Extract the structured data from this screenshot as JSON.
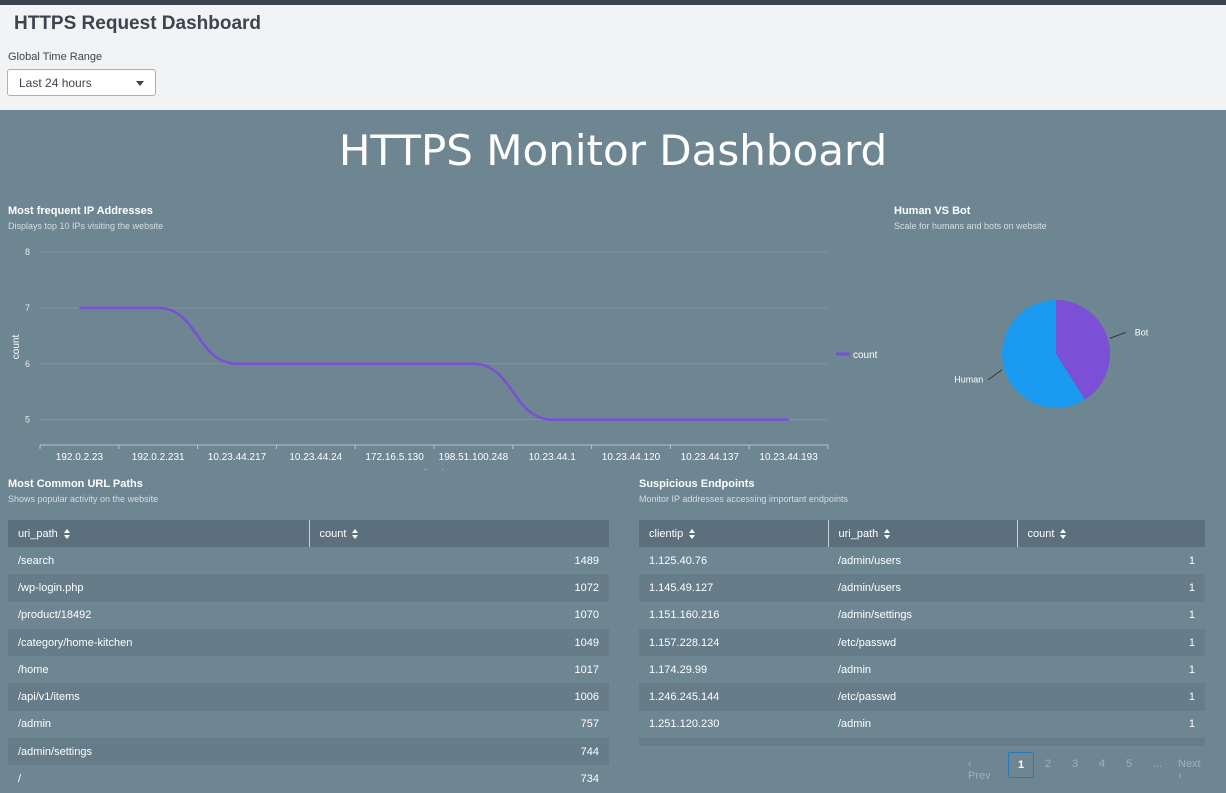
{
  "header": {
    "title": "HTTPS Request Dashboard",
    "time_range_label": "Global Time Range",
    "time_range_value": "Last 24 hours"
  },
  "dashboard_title": "HTTPS Monitor Dashboard",
  "colors": {
    "line": "#7b4fd6",
    "pie_human": "#1a9af0",
    "pie_bot": "#7b4fd6",
    "panel_bg": "#6e8592",
    "header_bg": "#f2f3f4",
    "pager_current_border": "#2a7ab8"
  },
  "ip_panel": {
    "title": "Most frequent IP Addresses",
    "subtitle": "Displays top 10 IPs visiting the website"
  },
  "bot_panel": {
    "title": "Human VS Bot",
    "subtitle": "Scale for humans and bots on website"
  },
  "chart_data": [
    {
      "type": "line",
      "x": [
        "192.0.2.23",
        "192.0.2.231",
        "10.23.44.217",
        "10.23.44.24",
        "172.16.5.130",
        "198.51.100.248",
        "10.23.44.1",
        "10.23.44.120",
        "10.23.44.137",
        "10.23.44.193"
      ],
      "series": [
        {
          "name": "count",
          "values": [
            7,
            7,
            6,
            6,
            6,
            6,
            5,
            5,
            5,
            5
          ]
        }
      ],
      "xlabel": "clientip",
      "ylabel": "count",
      "yticks": [
        5,
        6,
        7,
        8
      ],
      "ylim": [
        4.6,
        8
      ],
      "grid": true,
      "legend": "right"
    },
    {
      "type": "pie",
      "categories": [
        "Bot",
        "Human"
      ],
      "values": [
        41,
        59
      ],
      "legend": "labels"
    }
  ],
  "url_panel": {
    "title": "Most Common URL Paths",
    "subtitle": "Shows popular activity on the website",
    "headers": [
      "uri_path",
      "count"
    ],
    "rows": [
      [
        "/search",
        "1489"
      ],
      [
        "/wp-login.php",
        "1072"
      ],
      [
        "/product/18492",
        "1070"
      ],
      [
        "/category/home-kitchen",
        "1049"
      ],
      [
        "/home",
        "1017"
      ],
      [
        "/api/v1/items",
        "1006"
      ],
      [
        "/admin",
        "757"
      ],
      [
        "/admin/settings",
        "744"
      ],
      [
        "/",
        "734"
      ]
    ]
  },
  "endpoint_panel": {
    "title": "Suspicious Endpoints",
    "subtitle": "Monitor IP addresses accessing important endpoints",
    "headers": [
      "clientip",
      "uri_path",
      "count"
    ],
    "rows": [
      [
        "1.125.40.76",
        "/admin/users",
        "1"
      ],
      [
        "1.145.49.127",
        "/admin/users",
        "1"
      ],
      [
        "1.151.160.216",
        "/admin/settings",
        "1"
      ],
      [
        "1.157.228.124",
        "/etc/passwd",
        "1"
      ],
      [
        "1.174.29.99",
        "/admin",
        "1"
      ],
      [
        "1.246.245.144",
        "/etc/passwd",
        "1"
      ],
      [
        "1.251.120.230",
        "/admin",
        "1"
      ]
    ]
  },
  "pagination": {
    "prev": "Prev",
    "pages": [
      "1",
      "2",
      "3",
      "4",
      "5"
    ],
    "ellipsis": "...",
    "next": "Next",
    "current": "1"
  }
}
